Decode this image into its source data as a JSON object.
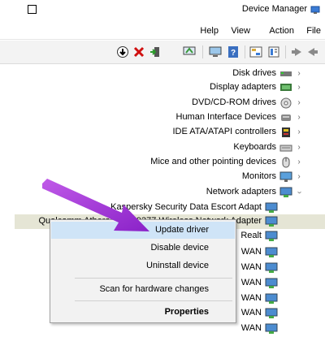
{
  "window": {
    "title": "Device Manager"
  },
  "menu": {
    "file": "File",
    "action": "Action",
    "view": "View",
    "help": "Help"
  },
  "toolbar": {
    "buttons": [
      "back-arrow-icon",
      "forward-arrow-icon",
      "properties-icon",
      "help-icon",
      "computer-scan-icon",
      "update-driver-icon",
      "delete-icon",
      "download-icon"
    ]
  },
  "tree": {
    "categories": [
      {
        "label": "Disk drives",
        "icon": "disk-drive-icon"
      },
      {
        "label": "Display adapters",
        "icon": "display-adapter-icon"
      },
      {
        "label": "DVD/CD-ROM drives",
        "icon": "dvd-drive-icon"
      },
      {
        "label": "Human Interface Devices",
        "icon": "hid-icon"
      },
      {
        "label": "IDE ATA/ATAPI controllers",
        "icon": "ide-controller-icon"
      },
      {
        "label": "Keyboards",
        "icon": "keyboard-icon"
      },
      {
        "label": "Mice and other pointing devices",
        "icon": "mouse-icon"
      },
      {
        "label": "Monitors",
        "icon": "monitor-icon"
      },
      {
        "label": "Network adapters",
        "icon": "network-adapter-icon"
      }
    ],
    "network_children": [
      "Kaspersky Security Data Escort Adapt",
      "Qualcomm Atheros QCA9377 Wireless Network Adapter",
      "Realt",
      "WAN",
      "WAN",
      "WAN",
      "WAN",
      "WAN",
      "WAN"
    ]
  },
  "context_menu": {
    "update_driver": "Update driver",
    "disable_device": "Disable device",
    "uninstall_device": "Uninstall device",
    "scan_hardware": "Scan for hardware changes",
    "properties": "Properties"
  },
  "colors": {
    "arrow": "#9b30d0",
    "highlight": "#cfe4f7",
    "menu_bg": "#f2f2f2"
  }
}
